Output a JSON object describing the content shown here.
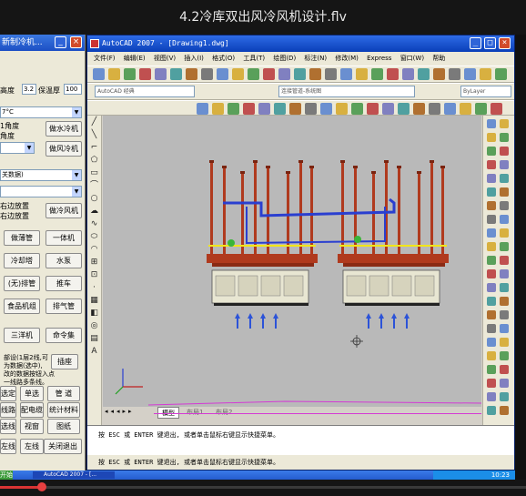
{
  "player": {
    "title": "4.2冷库双出风冷风机设计.flv",
    "progress": 0.08
  },
  "left_panel": {
    "title": "新制冷机...",
    "row1": {
      "label1": "高度",
      "value1": "3.2",
      "label2": "保温厚",
      "value2": "100"
    },
    "select1": "7°C",
    "line_a": "1角度",
    "line_b": "角度",
    "btn_water_cooler": "做水冷机",
    "btn_air_cooler": "做风冷机",
    "select2": "关数据)",
    "line_c": "右边放置",
    "line_d": "右边放置",
    "btn_air_cooler2": "做冷风机",
    "buttons": [
      "做薄管",
      "一体机",
      "冷却塔",
      "水泵",
      "(无)排管",
      "推车",
      "食品机组",
      "排气管",
      "三洋机",
      "命令集"
    ],
    "note_lines": [
      "部设(1层2线,可",
      "为数据(选中),",
      "改的数据按钮入点",
      "一线路多条线。"
    ],
    "small_btn": "插座",
    "bottom_buttons": [
      "选定",
      "单选",
      "管 道",
      "线路",
      "配电缆",
      "统计材料",
      "选线",
      "视窗",
      "图纸",
      "左线",
      "左线",
      "关闭退出"
    ]
  },
  "acad": {
    "title": "AutoCAD 2007 - [Drawing1.dwg]",
    "menu": [
      "文件(F)",
      "编辑(E)",
      "视图(V)",
      "插入(I)",
      "格式(O)",
      "工具(T)",
      "绘图(D)",
      "标注(N)",
      "修改(M)",
      "Express",
      "窗口(W)",
      "帮助"
    ],
    "workspace": "AutoCAD 经典",
    "layer": "连接管道-系统图",
    "bylayer": "ByLayer",
    "tabs": [
      "模型",
      "布局1",
      "布局2"
    ],
    "command_line": "按 ESC 或 ENTER 键退出, 或者单击鼠标右键显示快捷菜单。",
    "status_line": "按 ESC 或 ENTER 键退出, 或者单击鼠标右键显示快捷菜单。"
  },
  "taskbar": {
    "start": "开始",
    "task": "AutoCAD 2007 - [...",
    "clock": "10:23"
  },
  "colors": {
    "pipe_red": "#b03a1e",
    "pipe_blue": "#2a3fd0",
    "pipe_yellow": "#f2e619",
    "arrow_blue": "#2c53d8"
  }
}
